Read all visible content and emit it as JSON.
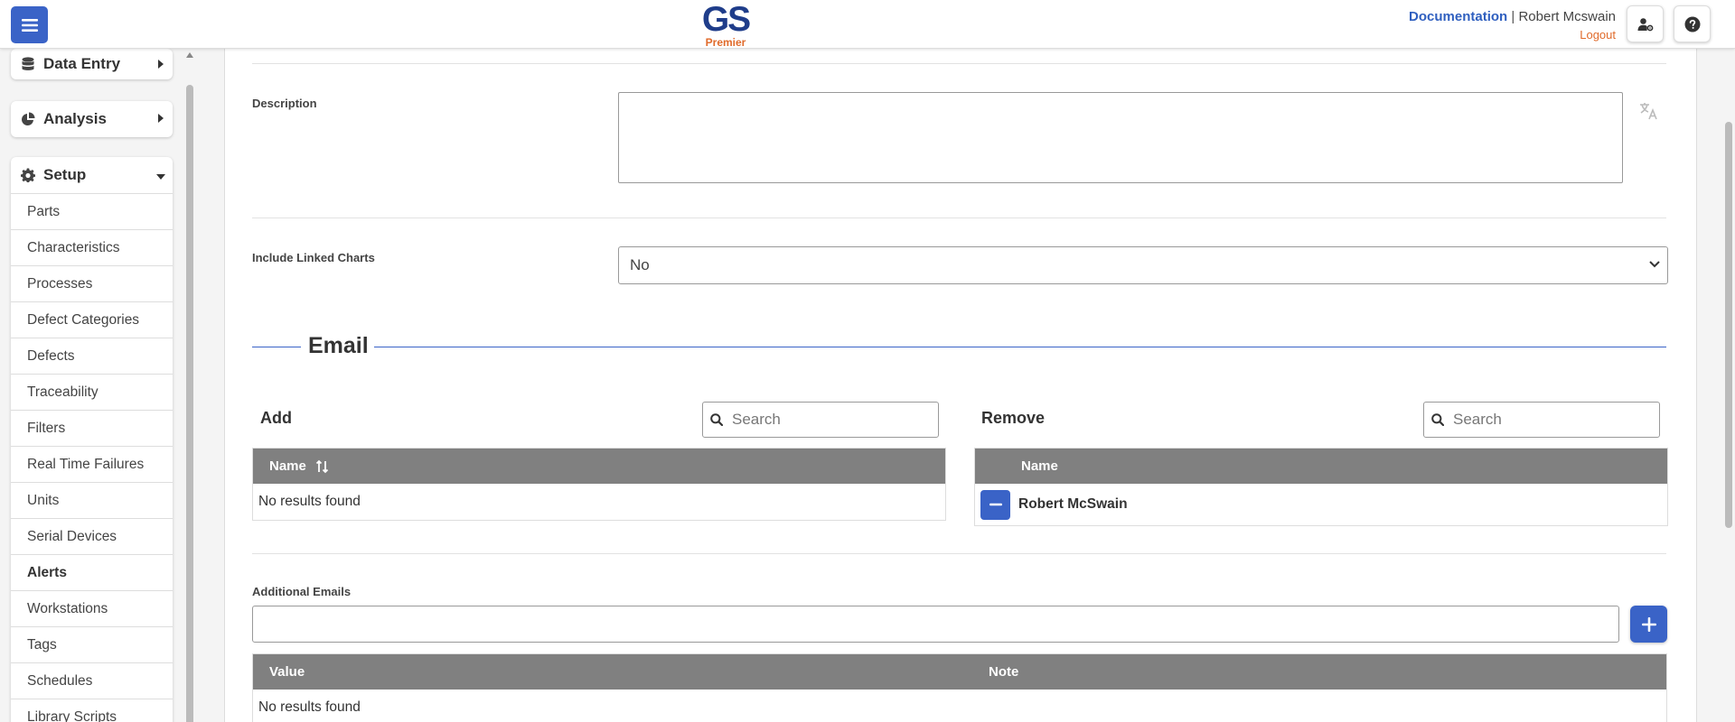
{
  "header": {
    "logo_main": "GS",
    "logo_sub": "Premier",
    "documentation_link": "Documentation",
    "separator": "|",
    "user_name": "Robert Mcswain",
    "logout_link": "Logout"
  },
  "sidebar": {
    "groups": [
      {
        "label": "Data Entry",
        "icon": "database-icon",
        "expanded": false
      },
      {
        "label": "Analysis",
        "icon": "pie-chart-icon",
        "expanded": false
      },
      {
        "label": "Setup",
        "icon": "gear-icon",
        "expanded": true
      }
    ],
    "setup_items": [
      "Parts",
      "Characteristics",
      "Processes",
      "Defect Categories",
      "Defects",
      "Traceability",
      "Filters",
      "Real Time Failures",
      "Units",
      "Serial Devices",
      "Alerts",
      "Workstations",
      "Tags",
      "Schedules",
      "Library Scripts"
    ],
    "active_item": "Alerts"
  },
  "form": {
    "description_label": "Description",
    "description_value": "",
    "include_linked_charts_label": "Include Linked Charts",
    "include_linked_charts_value": "No"
  },
  "email": {
    "section_title": "Email",
    "add": {
      "title": "Add",
      "search_placeholder": "Search",
      "column_name": "Name",
      "empty_text": "No results found"
    },
    "remove": {
      "title": "Remove",
      "search_placeholder": "Search",
      "column_name": "Name",
      "rows": [
        "Robert McSwain"
      ]
    }
  },
  "additional_emails": {
    "label": "Additional Emails",
    "input_value": "",
    "columns": [
      "Value",
      "Note"
    ],
    "empty_text": "No results found"
  },
  "colors": {
    "accent": "#3a63c7",
    "logo_blue": "#1f3d8a",
    "logo_orange": "#e06a2a",
    "table_header": "#808080"
  }
}
